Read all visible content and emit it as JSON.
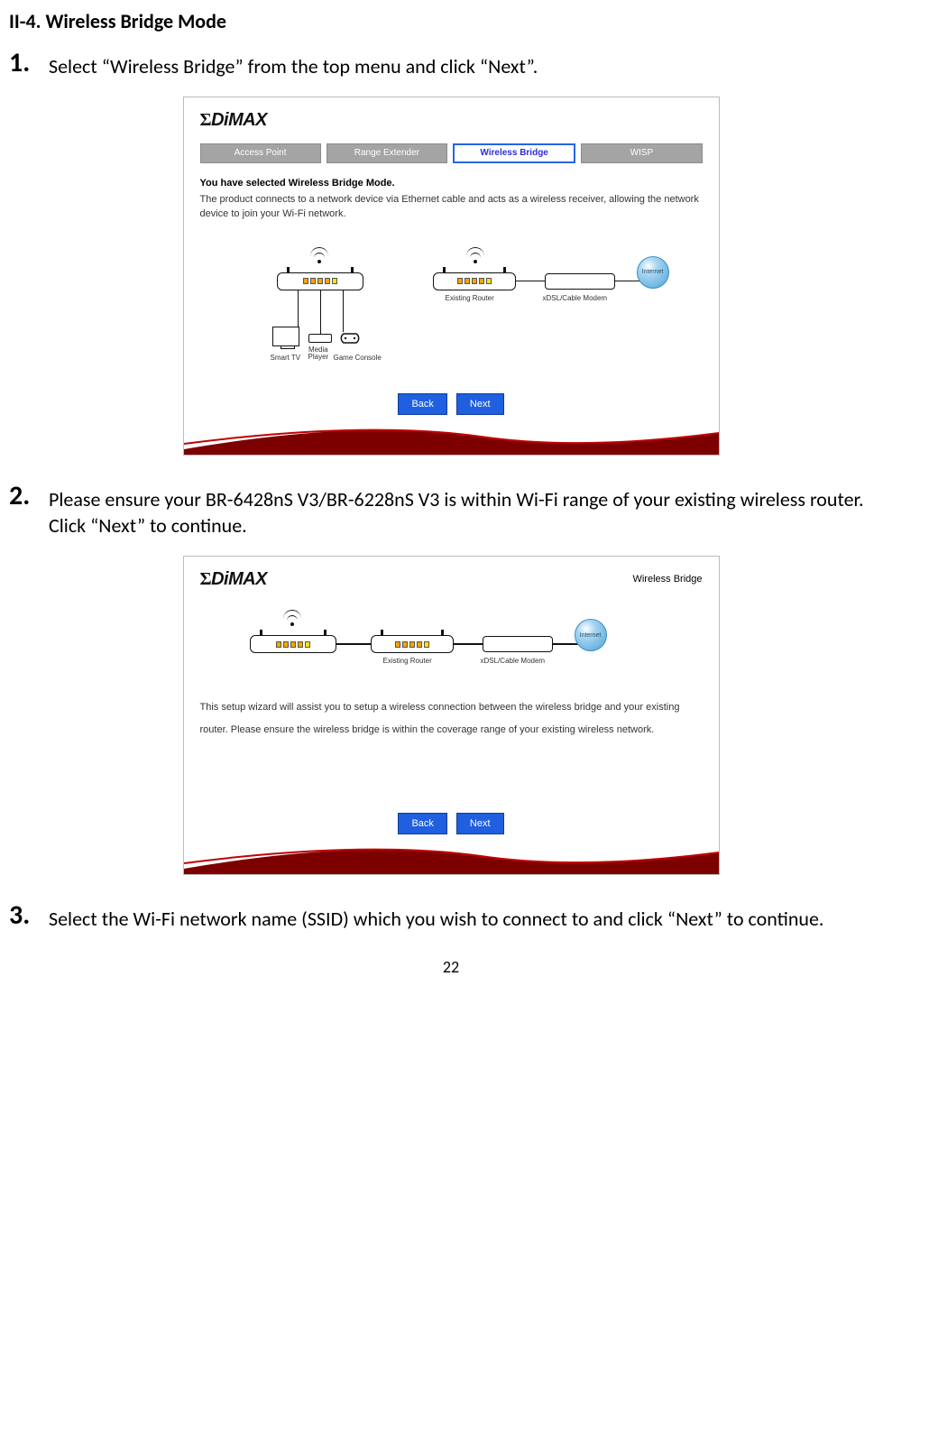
{
  "heading": "II-4. Wireless Bridge Mode",
  "steps": {
    "s1_num": "1.",
    "s1_text": "Select “Wireless Bridge” from the top menu and click “Next”.",
    "s2_num": "2.",
    "s2_text": "Please ensure your BR-6428nS V3/BR-6228nS V3 is within Wi-Fi range of your existing wireless router. Click “Next” to continue.",
    "s3_num": "3.",
    "s3_text": "Select the Wi-Fi network name (SSID) which you wish to connect to and click “Next” to continue."
  },
  "logo": "ΣDiMAX",
  "panel1": {
    "tabs": {
      "ap": "Access Point",
      "re": "Range Extender",
      "wb": "Wireless Bridge",
      "wisp": "WISP"
    },
    "mode_heading": "You have selected Wireless Bridge Mode.",
    "mode_desc": "The product connects to a network device via Ethernet cable and acts as a wireless receiver, allowing the network device to join your Wi-Fi network.",
    "labels": {
      "smart_tv": "Smart TV",
      "media": "Media\nPlayer",
      "game": "Game Console",
      "existing_router": "Existing Router",
      "modem": "xDSL/Cable Modem",
      "internet": "Internet"
    }
  },
  "panel2": {
    "mode_label": "Wireless Bridge",
    "desc": "This setup wizard will assist you to setup a wireless connection between the wireless bridge and your existing router. Please ensure the wireless bridge is within the coverage range of your existing wireless network.",
    "labels": {
      "existing_router": "Existing Router",
      "modem": "xDSL/Cable Modem",
      "internet": "Internet"
    }
  },
  "buttons": {
    "back": "Back",
    "next": "Next"
  },
  "page_number": "22"
}
